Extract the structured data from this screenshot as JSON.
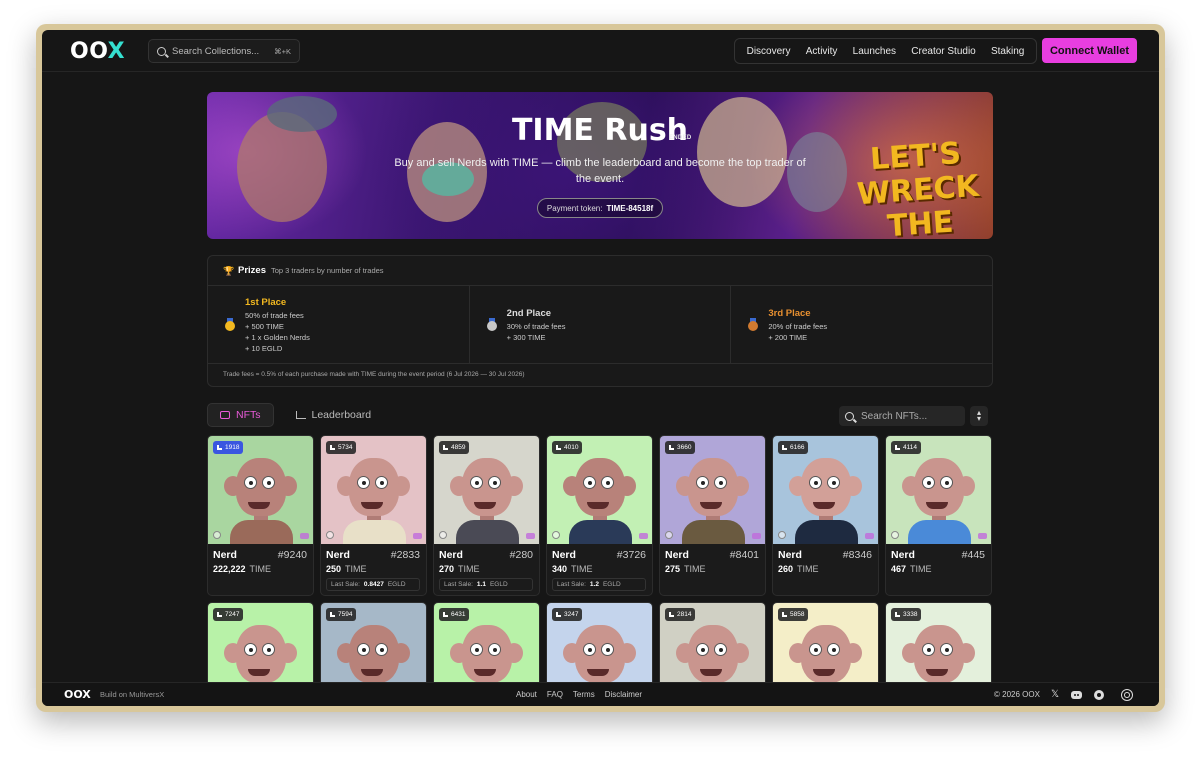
{
  "header": {
    "logo_main": "OO",
    "logo_accent": "X",
    "search_placeholder": "Search Collections...",
    "search_shortcut": "⌘+K",
    "nav": [
      "Discovery",
      "Activity",
      "Launches",
      "Creator Studio",
      "Staking"
    ],
    "connect_label": "Connect Wallet"
  },
  "banner": {
    "title": "TIME Rush",
    "status": "ENDED",
    "subtitle": "Buy and sell Nerds with TIME — climb the leaderboard and become the top trader of the event.",
    "token_label": "Payment token:",
    "token_value": "TIME-84518f",
    "art_text_1": "LET'S",
    "art_text_2": "WRECK",
    "art_text_3": "THE"
  },
  "prizes": {
    "title": "Prizes",
    "description": "Top 3 traders by number of trades",
    "places": [
      {
        "place": "1st Place",
        "lines": [
          "50% of trade fees",
          "+ 500 TIME",
          "+ 1 x Golden Nerds",
          "+ 10 EGLD"
        ],
        "color": "#f2b820"
      },
      {
        "place": "2nd Place",
        "lines": [
          "30% of trade fees",
          "+ 300 TIME"
        ],
        "color": "#dcdcdc"
      },
      {
        "place": "3rd Place",
        "lines": [
          "20% of trade fees",
          "+ 200 TIME"
        ],
        "color": "#e89030"
      }
    ],
    "fees_note": "Trade fees = 0.5% of each purchase made with TIME during the event period (6 Jul 2026 — 30 Jul 2026)"
  },
  "tabs": {
    "nfts": "NFTs",
    "leaderboard": "Leaderboard",
    "search_placeholder": "Search NFTs..."
  },
  "nfts": [
    {
      "rank": "1918",
      "name": "Nerd",
      "number": "#9240",
      "price": "222,222",
      "token": "TIME",
      "last_sale": "",
      "sale_token": "",
      "bg": "#a9d6a0",
      "skin": "#b8827a",
      "shirt": "#9a6a5a",
      "highlight": true
    },
    {
      "rank": "5734",
      "name": "Nerd",
      "number": "#2833",
      "price": "250",
      "token": "TIME",
      "last_sale": "0.8427",
      "sale_token": "EGLD",
      "bg": "#e4c2c6",
      "skin": "#c9958e",
      "shirt": "#e8e0c8",
      "highlight": false
    },
    {
      "rank": "4859",
      "name": "Nerd",
      "number": "#280",
      "price": "270",
      "token": "TIME",
      "last_sale": "1.1",
      "sale_token": "EGLD",
      "bg": "#d6d6cc",
      "skin": "#c9958e",
      "shirt": "#4a4a55",
      "highlight": false
    },
    {
      "rank": "4010",
      "name": "Nerd",
      "number": "#3726",
      "price": "340",
      "token": "TIME",
      "last_sale": "1.2",
      "sale_token": "EGLD",
      "bg": "#c2f0b4",
      "skin": "#b8827a",
      "shirt": "#2a3a58",
      "highlight": false
    },
    {
      "rank": "3660",
      "name": "Nerd",
      "number": "#8401",
      "price": "275",
      "token": "TIME",
      "last_sale": "",
      "sale_token": "",
      "bg": "#b0a6d8",
      "skin": "#c9958e",
      "shirt": "#6a5a40",
      "highlight": false
    },
    {
      "rank": "6166",
      "name": "Nerd",
      "number": "#8346",
      "price": "260",
      "token": "TIME",
      "last_sale": "",
      "sale_token": "",
      "bg": "#a8c4dc",
      "skin": "#d2a098",
      "shirt": "#1e2a40",
      "highlight": false
    },
    {
      "rank": "4114",
      "name": "Nerd",
      "number": "#445",
      "price": "467",
      "token": "TIME",
      "last_sale": "",
      "sale_token": "",
      "bg": "#c8e4bc",
      "skin": "#c9958e",
      "shirt": "#4a8ad8",
      "highlight": false
    },
    {
      "rank": "7247",
      "name": "",
      "number": "",
      "price": "",
      "token": "",
      "last_sale": "",
      "sale_token": "",
      "bg": "#b8f2a8",
      "skin": "#c9958e",
      "shirt": "#555",
      "highlight": false
    },
    {
      "rank": "7594",
      "name": "",
      "number": "",
      "price": "",
      "token": "",
      "last_sale": "",
      "sale_token": "",
      "bg": "#a6b8c8",
      "skin": "#b8827a",
      "shirt": "#555",
      "highlight": false
    },
    {
      "rank": "6431",
      "name": "",
      "number": "",
      "price": "",
      "token": "",
      "last_sale": "",
      "sale_token": "",
      "bg": "#b8f2a8",
      "skin": "#c9958e",
      "shirt": "#555",
      "highlight": false
    },
    {
      "rank": "3247",
      "name": "",
      "number": "",
      "price": "",
      "token": "",
      "last_sale": "",
      "sale_token": "",
      "bg": "#c4d4ec",
      "skin": "#c9958e",
      "shirt": "#555",
      "highlight": false
    },
    {
      "rank": "2814",
      "name": "",
      "number": "",
      "price": "",
      "token": "",
      "last_sale": "",
      "sale_token": "",
      "bg": "#d0d0c4",
      "skin": "#c9958e",
      "shirt": "#555",
      "highlight": false
    },
    {
      "rank": "5858",
      "name": "",
      "number": "",
      "price": "",
      "token": "",
      "last_sale": "",
      "sale_token": "",
      "bg": "#f4eec8",
      "skin": "#c9958e",
      "shirt": "#555",
      "highlight": false
    },
    {
      "rank": "3338",
      "name": "",
      "number": "",
      "price": "",
      "token": "",
      "last_sale": "",
      "sale_token": "",
      "bg": "#e4f0dc",
      "skin": "#c9958e",
      "shirt": "#555",
      "highlight": false
    }
  ],
  "labels": {
    "last_sale": "Last Sale:"
  },
  "footer": {
    "logo": "OOX",
    "built": "Build on MultiversX",
    "links": [
      "About",
      "FAQ",
      "Terms",
      "Disclaimer"
    ],
    "copyright": "© 2026 OOX"
  },
  "colors": {
    "accent": "#e83ee0",
    "logo_accent": "#35e0d0",
    "background": "#161616"
  }
}
